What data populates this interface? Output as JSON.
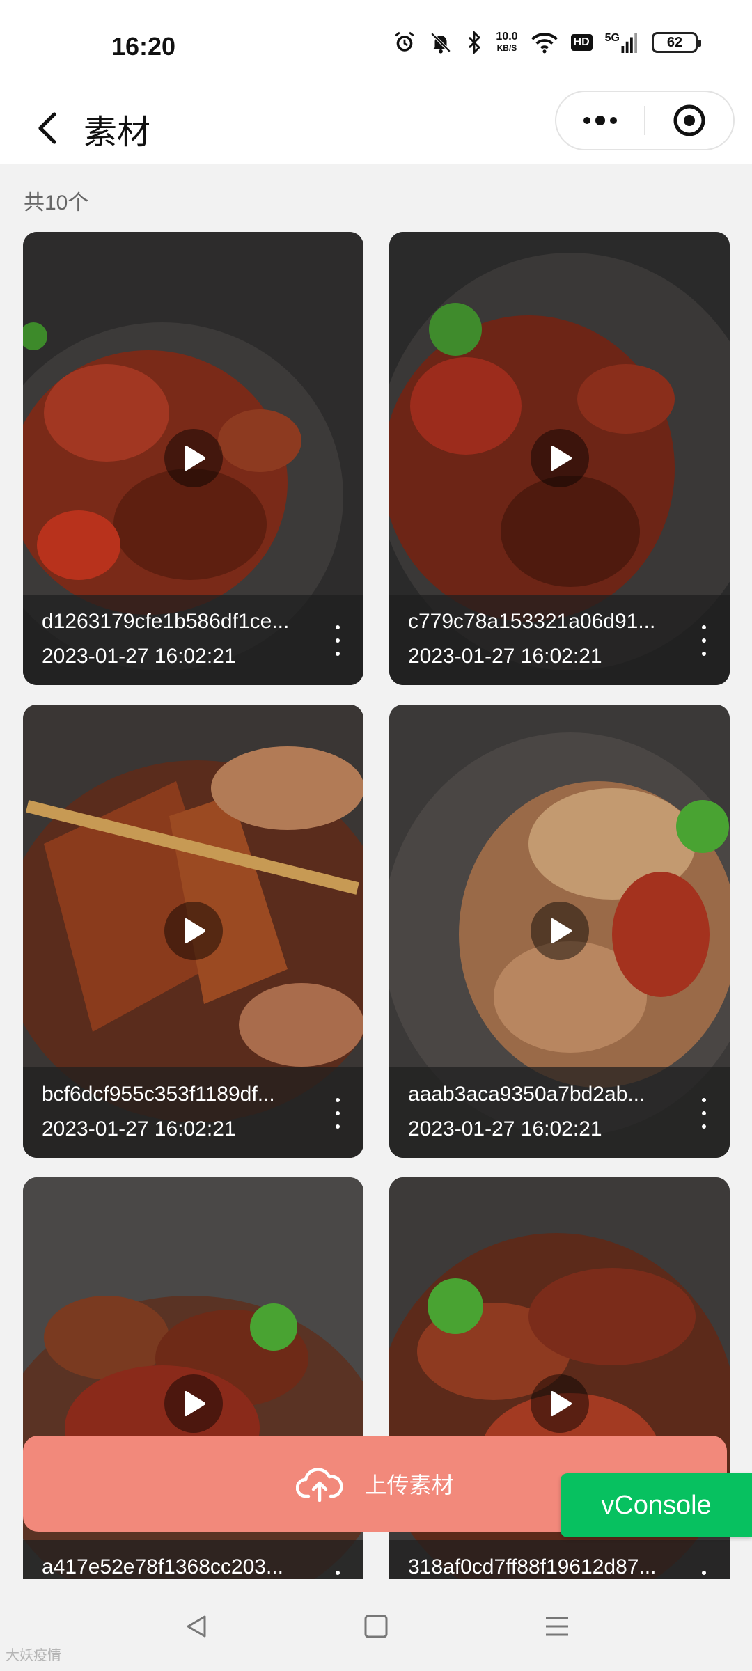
{
  "status_bar": {
    "time": "16:20",
    "net_speed_value": "10.0",
    "net_speed_unit": "KB/S",
    "hd_label": "HD",
    "network_label": "5G",
    "battery": "62",
    "icons": [
      "alarm-icon",
      "mute-icon",
      "bluetooth-icon",
      "wifi-icon",
      "signal-icon"
    ]
  },
  "header": {
    "title": "素材",
    "back_icon": "chevron-left-icon",
    "more_icon": "more-dots-icon",
    "close_icon": "target-icon"
  },
  "list": {
    "count_label": "共10个",
    "items": [
      {
        "name": "d1263179cfe1b586df1ce...",
        "date": "2023-01-27 16:02:21",
        "theme": "#7a2a18"
      },
      {
        "name": "c779c78a153321a06d91...",
        "date": "2023-01-27 16:02:21",
        "theme": "#6d2516"
      },
      {
        "name": "bcf6dcf955c353f1189df...",
        "date": "2023-01-27 16:02:21",
        "theme": "#8a3b1c"
      },
      {
        "name": "aaab3aca9350a7bd2ab...",
        "date": "2023-01-27 16:02:21",
        "theme": "#9a6a48"
      },
      {
        "name": "a417e52e78f1368cc203...",
        "date": "",
        "theme": "#6e2a17"
      },
      {
        "name": "318af0cd7ff88f19612d87...",
        "date": "",
        "theme": "#7b2c1a"
      }
    ]
  },
  "upload": {
    "label": "上传素材",
    "icon": "cloud-upload-icon"
  },
  "vconsole": {
    "label": "vConsole"
  },
  "nav": {
    "back_icon": "nav-back-icon",
    "home_icon": "nav-home-icon",
    "menu_icon": "nav-menu-icon"
  },
  "watermark": "大妖疫情"
}
